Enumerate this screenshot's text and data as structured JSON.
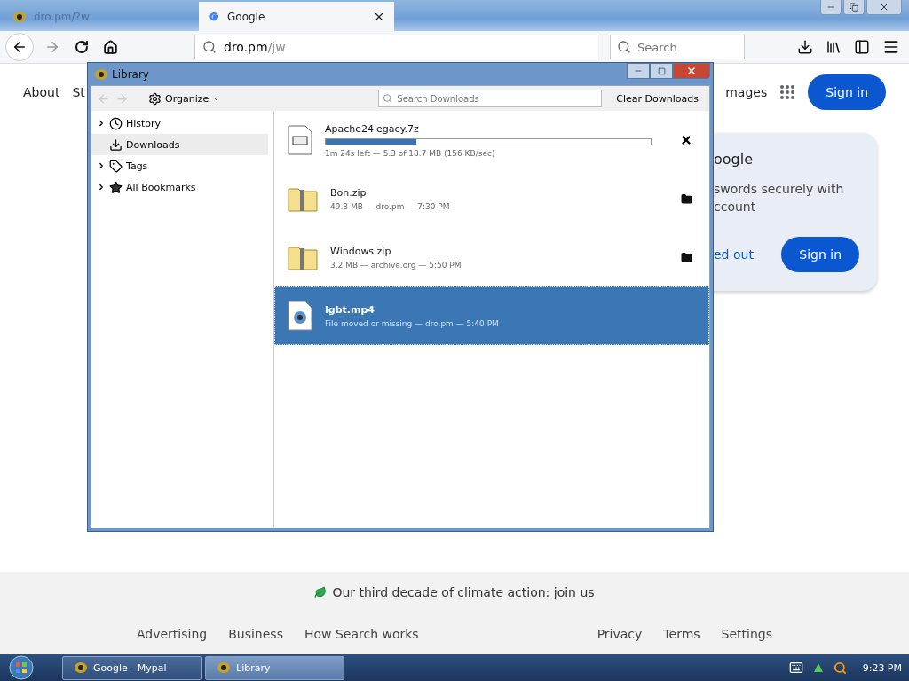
{
  "browser": {
    "tabs": [
      {
        "title": "dro.pm/?w",
        "selected": false
      },
      {
        "title": "Google",
        "selected": true
      }
    ],
    "address": {
      "host": "dro.pm",
      "path": "/jw"
    },
    "search": {
      "placeholder": "Search"
    }
  },
  "page": {
    "nav_left": [
      "About",
      "St"
    ],
    "nav_right": [
      "mages"
    ],
    "sign_in": "Sign in",
    "card": {
      "title": "oogle",
      "lines": [
        "swords securely with",
        "ccount"
      ],
      "link": "ed out",
      "button": "Sign in"
    },
    "footer": {
      "climate": "Our third decade of climate action: join us",
      "links_left": [
        "Advertising",
        "Business",
        "How Search works"
      ],
      "links_right": [
        "Privacy",
        "Terms",
        "Settings"
      ]
    }
  },
  "library": {
    "title": "Library",
    "organize": "Organize",
    "search": {
      "placeholder": "Search Downloads"
    },
    "clear": "Clear Downloads",
    "sidebar": [
      {
        "label": "History",
        "expandable": true,
        "selected": false
      },
      {
        "label": "Downloads",
        "expandable": false,
        "selected": true
      },
      {
        "label": "Tags",
        "expandable": true,
        "selected": false
      },
      {
        "label": "All Bookmarks",
        "expandable": true,
        "selected": false
      }
    ],
    "downloads": [
      {
        "kind": "progress",
        "name": "Apache24legacy.7z",
        "level": 0.28,
        "status": "1m 24s left — 5.3 of 18.7 MB (156 KB/sec)",
        "selected": false
      },
      {
        "kind": "done",
        "name": "Bon.zip",
        "status": "49.8 MB — dro.pm — 7:30 PM",
        "selected": false
      },
      {
        "kind": "done",
        "name": "Windows.zip",
        "status": "3.2 MB — archive.org — 5:50 PM",
        "selected": false
      },
      {
        "kind": "missing",
        "name": "lgbt.mp4",
        "status": "File moved or missing — dro.pm — 5:40 PM",
        "selected": true
      }
    ]
  },
  "taskbar": {
    "items": [
      {
        "label": "Google - Mypal",
        "selected": false
      },
      {
        "label": "Library",
        "selected": true
      }
    ],
    "clock": "9:23 PM"
  }
}
